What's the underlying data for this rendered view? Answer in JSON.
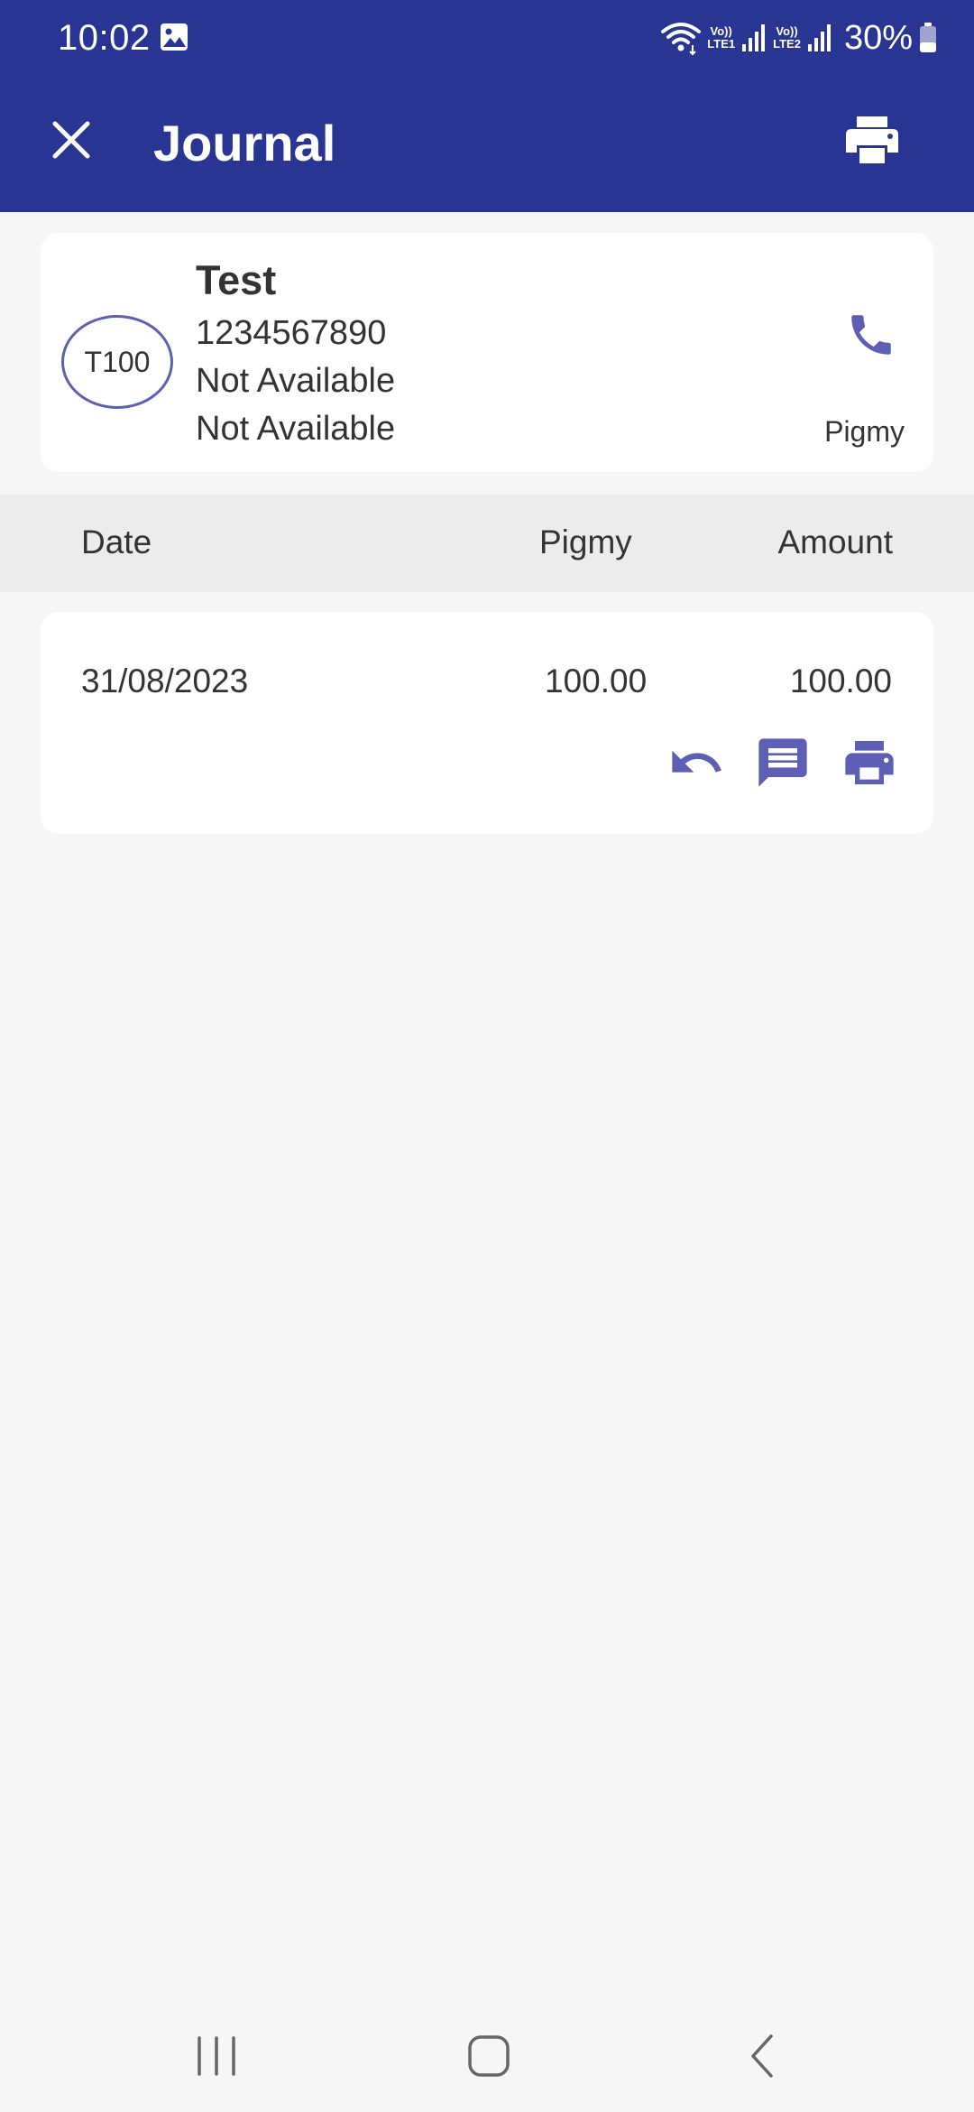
{
  "status_bar": {
    "time": "10:02",
    "sim1_badge_top": "Vo))",
    "sim1_badge_bottom": "LTE1",
    "sim2_badge_top": "Vo))",
    "sim2_badge_bottom": "LTE2",
    "battery_percent": "30%",
    "icons": [
      "gallery-icon",
      "wifi-icon",
      "signal-icon",
      "battery-icon"
    ]
  },
  "app_bar": {
    "title": "Journal",
    "close_icon": "close-icon",
    "print_icon": "printer-icon"
  },
  "customer": {
    "avatar_code": "T100",
    "name": "Test",
    "phone": "1234567890",
    "line1": "Not Available",
    "line2": "Not Available",
    "account_type": "Pigmy",
    "call_icon": "phone-icon"
  },
  "table": {
    "headers": {
      "date": "Date",
      "pigmy": "Pigmy",
      "amount": "Amount"
    },
    "rows": [
      {
        "date": "31/08/2023",
        "pigmy": "100.00",
        "amount": "100.00",
        "actions": [
          "undo-icon",
          "message-icon",
          "printer-icon"
        ]
      }
    ]
  },
  "nav_bar": {
    "icons": [
      "recents-icon",
      "home-icon",
      "back-icon"
    ]
  },
  "colors": {
    "app_bar": "#283593",
    "accent": "#5c5fb3",
    "background": "#f6f6f6",
    "card": "#ffffff",
    "table_header": "#ececec",
    "text": "#333333"
  }
}
